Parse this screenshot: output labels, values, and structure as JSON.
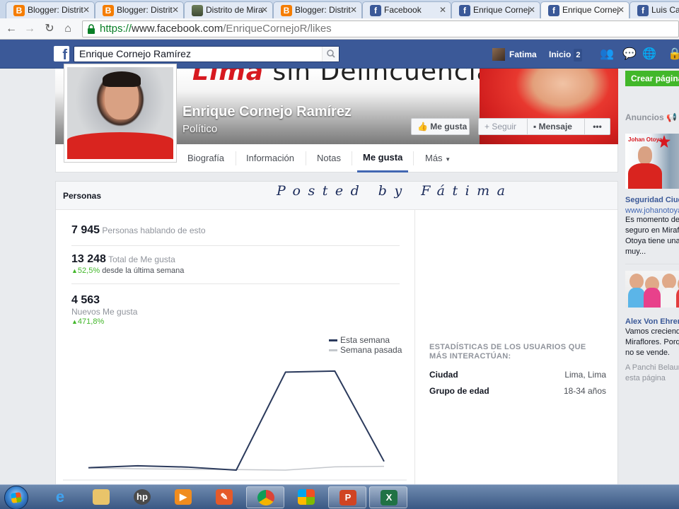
{
  "browser": {
    "tabs": [
      {
        "label": "Blogger: Distrit",
        "icon": "blogger",
        "active": false
      },
      {
        "label": "Blogger: Distrit",
        "icon": "blogger",
        "active": false
      },
      {
        "label": "Distrito de Mira",
        "icon": "photo",
        "active": false
      },
      {
        "label": "Blogger: Distrit",
        "icon": "blogger",
        "active": false
      },
      {
        "label": "Facebook",
        "icon": "facebook",
        "active": false
      },
      {
        "label": "Enrique Cornej",
        "icon": "facebook",
        "active": false
      },
      {
        "label": "Enrique Cornej",
        "icon": "facebook",
        "active": true
      },
      {
        "label": "Luis Cast",
        "icon": "facebook",
        "active": false
      }
    ],
    "url": {
      "scheme": "https://",
      "host": "www.facebook.com",
      "path": "/EnriqueCornejoR/likes"
    }
  },
  "fbbar": {
    "search_value": "Enrique Cornejo Ramírez",
    "user_name": "Fatima",
    "home_label": "Inicio",
    "home_count": "2"
  },
  "cover": {
    "slogan_red": "Lima",
    "slogan_rest": " sin Delincuencia",
    "name": "Enrique Cornejo Ramírez",
    "category": "Político",
    "like_button": "Me gusta",
    "follow_button": "Seguir",
    "message_button": "Mensaje",
    "more_button": "•••"
  },
  "nav": {
    "tabs": [
      "Biografía",
      "Información",
      "Notas",
      "Me gusta",
      "Más"
    ],
    "active": "Me gusta"
  },
  "panel": {
    "title": "Personas",
    "overlay_text": "Posted by Fátima",
    "stats": {
      "talking_count": "7 945",
      "talking_label": "Personas hablando de esto",
      "total_count": "13 248",
      "total_label": "Total de Me gusta",
      "total_trend_pct": "52,5%",
      "total_trend_label": "desde la última semana",
      "new_count": "4 563",
      "new_label": "Nuevos Me gusta",
      "new_trend_pct": "471,8%"
    },
    "right": {
      "title": "ESTADÍSTICAS DE LOS USUARIOS QUE MÁS INTERACTÚAN:",
      "rows": [
        {
          "key": "Ciudad",
          "value": "Lima, Lima"
        },
        {
          "key": "Grupo de edad",
          "value": "18-34 años"
        }
      ]
    }
  },
  "chart_data": {
    "type": "line",
    "title": "",
    "xlabel": "",
    "ylabel": "",
    "x": [
      1,
      2,
      3,
      4,
      5,
      6,
      7
    ],
    "ylim": [
      0,
      1000
    ],
    "grid": false,
    "legend_position": "top-right",
    "series": [
      {
        "name": "Esta semana",
        "color": "#2b3a5c",
        "values": [
          22,
          40,
          28,
          0,
          900,
          910,
          80
        ]
      },
      {
        "name": "Semana pasada",
        "color": "#c4c7cc",
        "values": [
          20,
          12,
          8,
          5,
          0,
          30,
          35
        ]
      }
    ]
  },
  "sidebar": {
    "create_button": "Crear página",
    "ads_title": "Anuncios",
    "ad1": {
      "brand": "Johan Otoya",
      "title": "Seguridad Ciud",
      "url": "www.johanotoya",
      "text": "Es momento de seguro en Miraflo Otoya tiene una muy..."
    },
    "ad2": {
      "title": "Alex Von Ehren",
      "text": "Vamos creciendo Miraflores. Porqu no se vende.",
      "social": "A Panchi Belaun esta página"
    }
  },
  "colors": {
    "fb_blue": "#3b5998",
    "green": "#42b72a",
    "series_this_week": "#2b3a5c",
    "series_last_week": "#c4c7cc"
  }
}
